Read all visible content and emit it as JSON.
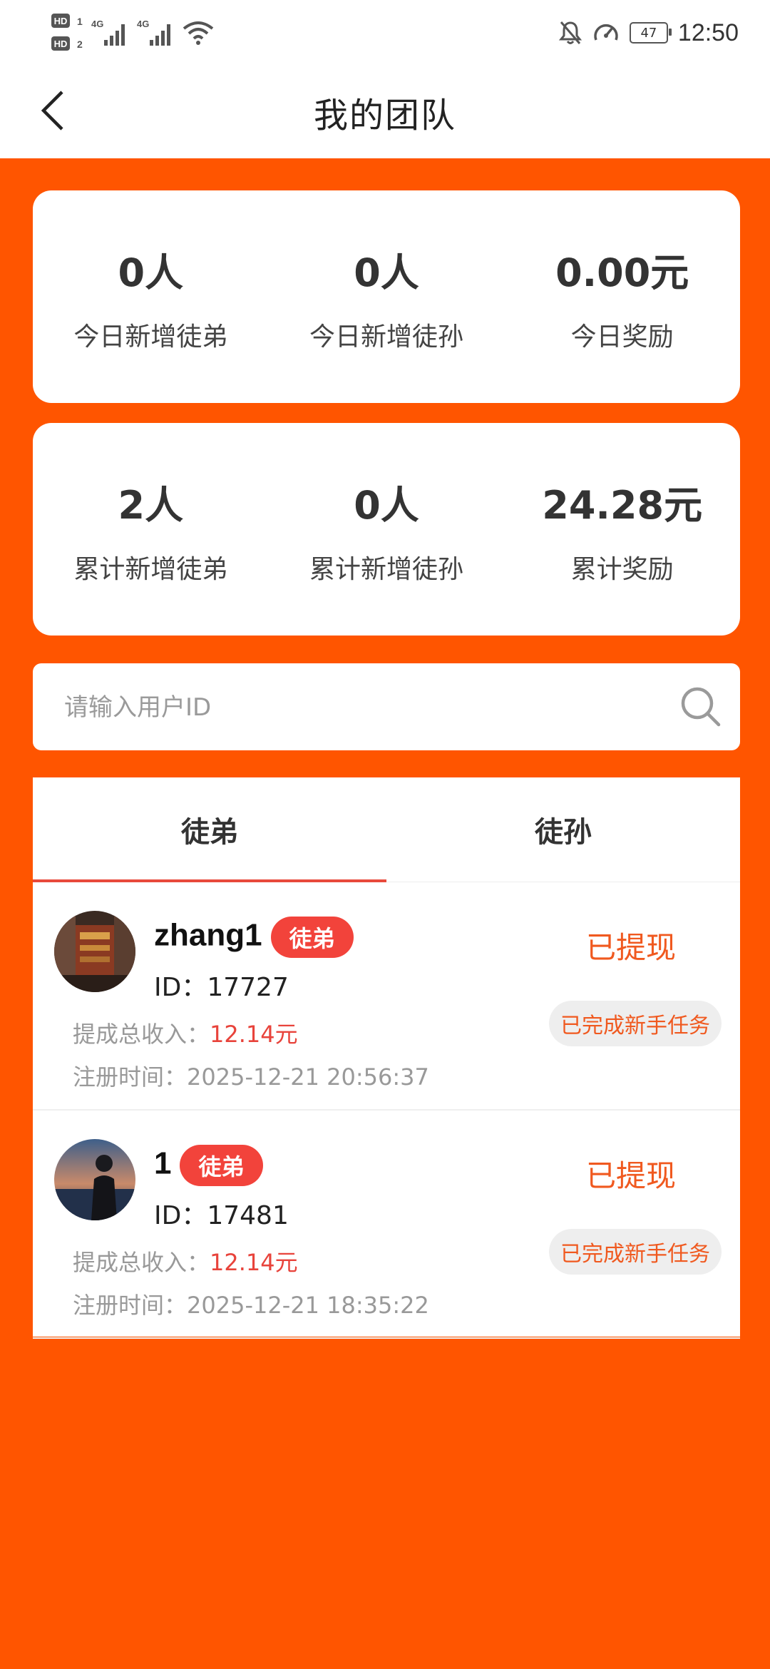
{
  "status_bar": {
    "left_icons": [
      "hd-icon",
      "signal-4g-icon",
      "signal-4g-icon",
      "wifi-icon"
    ],
    "network_1": "4G",
    "network_2": "4G",
    "hd_1": "HD",
    "hd_2": "HD",
    "battery": "47",
    "time": "12:50"
  },
  "nav": {
    "title": "我的团队"
  },
  "today_stats": [
    {
      "value": "0人",
      "label": "今日新增徒弟"
    },
    {
      "value": "0人",
      "label": "今日新增徒孙"
    },
    {
      "value": "0.00元",
      "label": "今日奖励"
    }
  ],
  "total_stats": [
    {
      "value": "2人",
      "label": "累计新增徒弟"
    },
    {
      "value": "0人",
      "label": "累计新增徒孙"
    },
    {
      "value": "24.28元",
      "label": "累计奖励"
    }
  ],
  "search": {
    "placeholder": "请输入用户ID",
    "value": ""
  },
  "tabs": [
    {
      "label": "徒弟",
      "active": true
    },
    {
      "label": "徒孙",
      "active": false
    }
  ],
  "members": [
    {
      "name": "zhang1",
      "badge": "徒弟",
      "id_text": "ID：17727",
      "income_label": "提成总收入：",
      "income_value": "12.14元",
      "reg_text": "注册时间：2025-12-21 20:56:37",
      "status": "已提现",
      "task": "已完成新手任务"
    },
    {
      "name": "1",
      "badge": "徒弟",
      "id_text": "ID：17481",
      "income_label": "提成总收入：",
      "income_value": "12.14元",
      "reg_text": "注册时间：2025-12-21 18:35:22",
      "status": "已提现",
      "task": "已完成新手任务"
    }
  ],
  "colors": {
    "background": "#FF5500",
    "accent_red": "#F2433B",
    "status_orange": "#F0591F",
    "card": "#FFFFFF"
  }
}
